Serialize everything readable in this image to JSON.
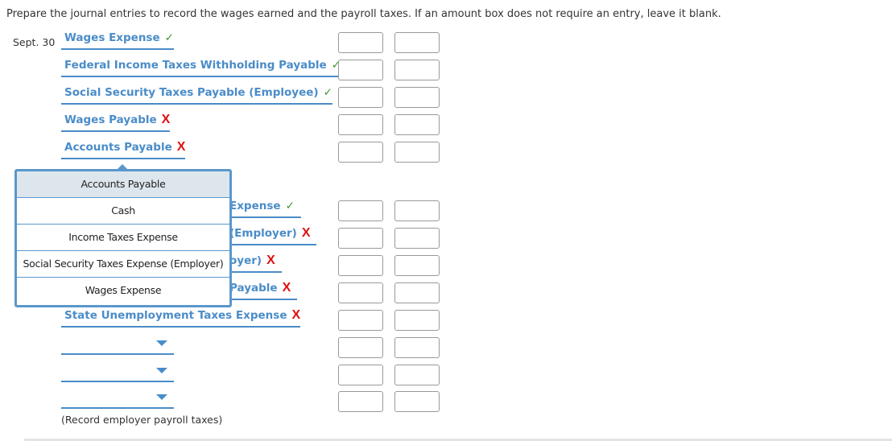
{
  "instruction": "Prepare the journal entries to record the wages earned and the payroll taxes. If an amount box does not require an entry, leave it blank.",
  "entry1": {
    "date": "Sept. 30",
    "rows": [
      {
        "account": "Wages Expense",
        "status": "correct"
      },
      {
        "account": "Federal Income Taxes Withholding Payable",
        "status": "correct"
      },
      {
        "account": "Social Security Taxes Payable (Employee)",
        "status": "correct"
      },
      {
        "account": "Wages Payable",
        "status": "incorrect"
      },
      {
        "account": "Accounts Payable",
        "status": "incorrect"
      }
    ]
  },
  "entry2": {
    "rows_partial": [
      {
        "account_visible": "Expense",
        "status": "correct"
      },
      {
        "account_visible": "(Employer)",
        "status": "incorrect"
      },
      {
        "account_visible": "oyer)",
        "status": "incorrect"
      },
      {
        "account_visible": "Payable",
        "status": "incorrect"
      },
      {
        "account": "State Unemployment Taxes Expense",
        "status": "incorrect"
      }
    ],
    "note": "(Record employer payroll taxes)"
  },
  "dropdown": {
    "options": [
      "Accounts Payable",
      "Cash",
      "Income Taxes Expense",
      "Social Security Taxes Expense (Employer)",
      "Wages Expense"
    ],
    "highlighted": "Accounts Payable"
  },
  "marks": {
    "correct": "✓",
    "incorrect": "X"
  },
  "colors": {
    "accent": "#4a8cc8",
    "correct": "#3a9a2a",
    "incorrect": "#e01010"
  }
}
